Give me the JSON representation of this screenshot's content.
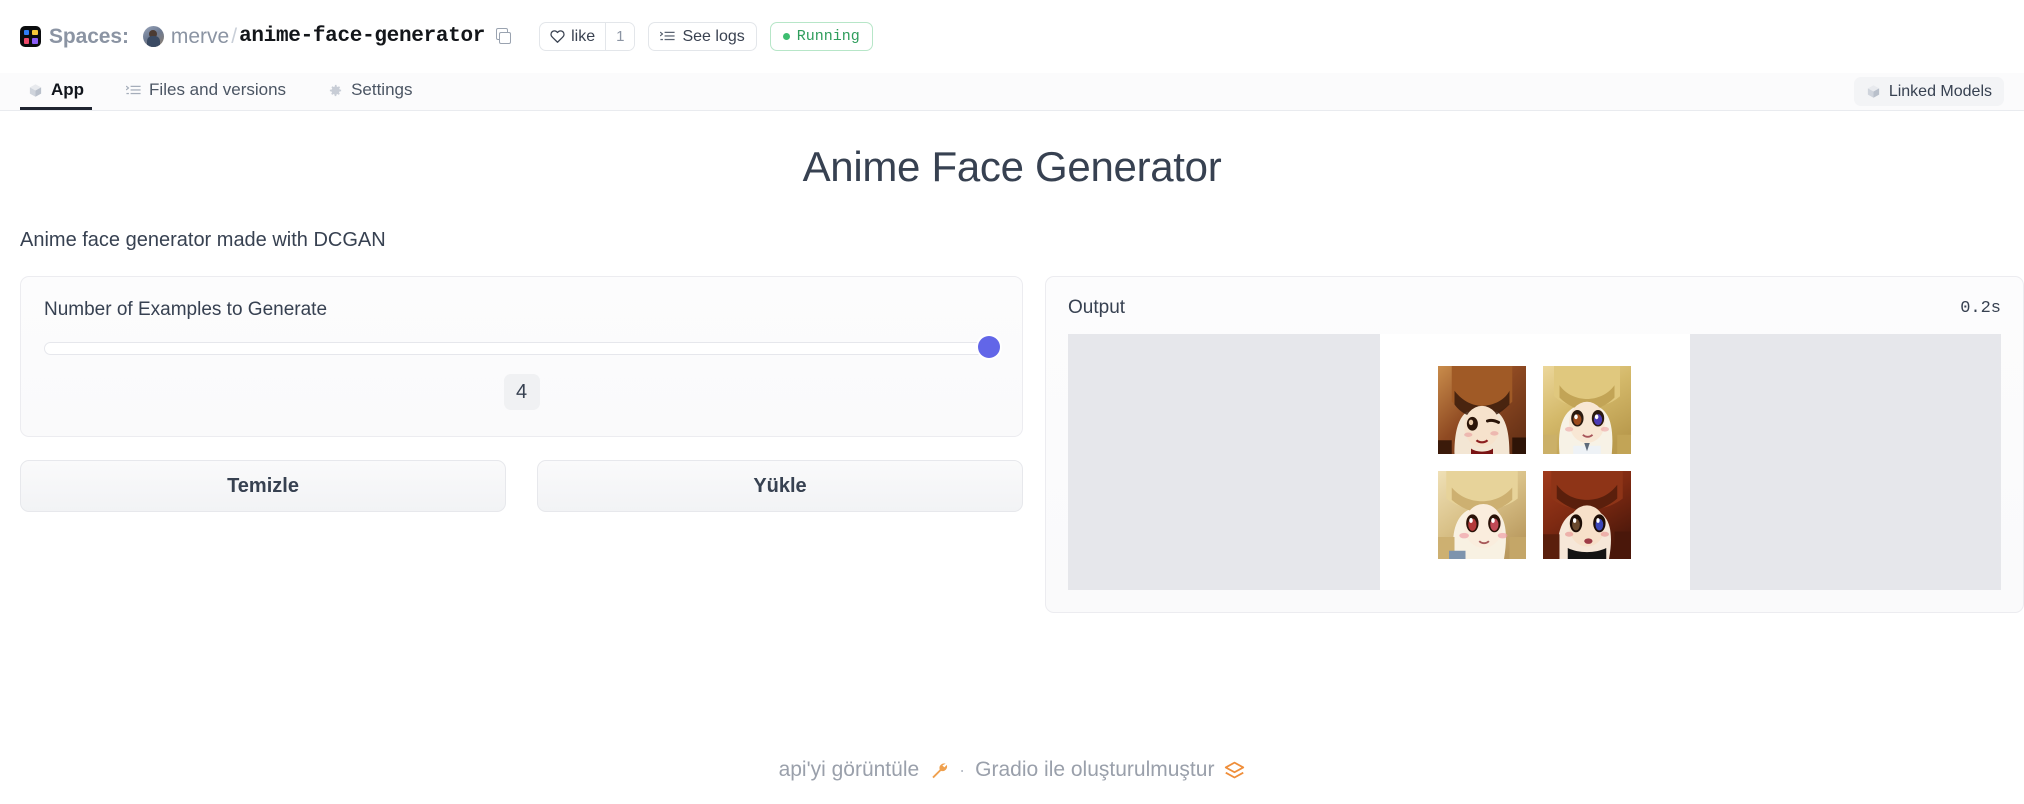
{
  "topbar": {
    "spaces_logo_icon": "spaces-logo-icon",
    "spaces_logo_colors": [
      "#2f7cf6",
      "#f6c737",
      "#ef4a6b",
      "#8b5cf6"
    ],
    "spaces_label": "Spaces:",
    "owner": "merve",
    "separator": "/",
    "repo_name": "anime-face-generator",
    "copy_icon": "copy-icon",
    "like": {
      "icon": "heart-icon",
      "label": "like",
      "count": "1"
    },
    "see_logs": {
      "icon": "logs-icon",
      "label": "See logs"
    },
    "status": {
      "label": "Running",
      "dot_color": "#3dbd70",
      "text_color": "#2f9d5c"
    }
  },
  "nav": {
    "tabs": [
      {
        "label": "App",
        "icon": "cube-icon",
        "active": true
      },
      {
        "label": "Files and versions",
        "icon": "files-icon",
        "active": false
      },
      {
        "label": "Settings",
        "icon": "gear-icon",
        "active": false
      }
    ],
    "linked_models": {
      "label": "Linked Models",
      "icon": "cube-icon"
    }
  },
  "app": {
    "title": "Anime Face Generator",
    "description": "Anime face generator made with DCGAN",
    "slider": {
      "label": "Number of Examples to Generate",
      "value": "4",
      "fill_percent": 100,
      "thumb_color": "#6266e8"
    },
    "buttons": {
      "clear": "Temizle",
      "submit": "Yükle"
    },
    "output": {
      "label": "Output",
      "duration": "0.2s",
      "placeholder_color": "#e6e7eb",
      "images": [
        {
          "name": "anime-face-1",
          "alt": "anime face brown hair bangs"
        },
        {
          "name": "anime-face-2",
          "alt": "anime face blonde hair big eyes"
        },
        {
          "name": "anime-face-3",
          "alt": "anime face light blonde red eyes"
        },
        {
          "name": "anime-face-4",
          "alt": "anime face dark red hair blue eyes"
        }
      ]
    }
  },
  "footer": {
    "api_link": "api'yi görüntüle",
    "wrench_icon": "wrench-icon",
    "separator": "·",
    "built_with": "Gradio ile oluşturulmuştur",
    "gradio_icon": "gradio-logo-icon"
  }
}
